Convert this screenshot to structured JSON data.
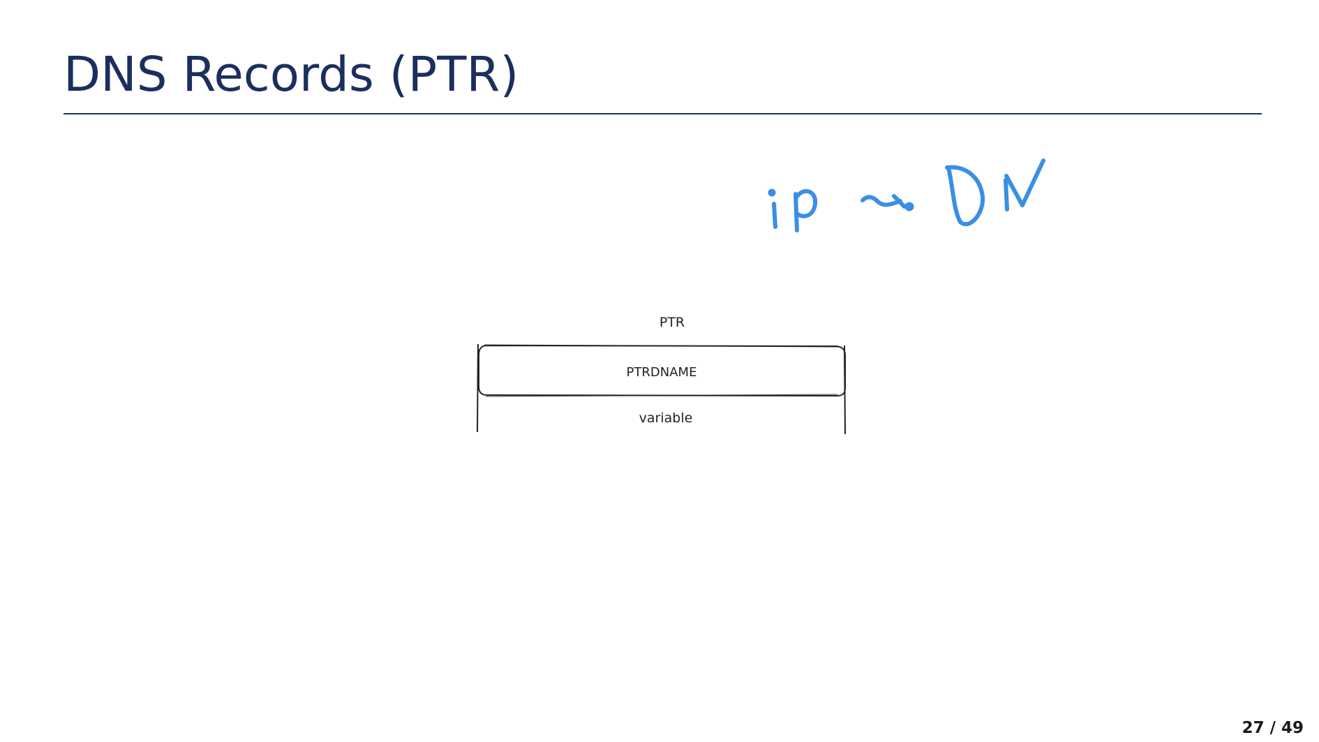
{
  "slide": {
    "title": "DNS Records (PTR)",
    "page_number": "27 / 49"
  },
  "annotation": {
    "text": "ip ~> DN",
    "color": "#3a8ee6"
  },
  "diagram": {
    "record_type": "PTR",
    "field_name": "PTRDNAME",
    "field_length": "variable"
  },
  "colors": {
    "title": "#1b2f5e",
    "ink": "#222222"
  }
}
